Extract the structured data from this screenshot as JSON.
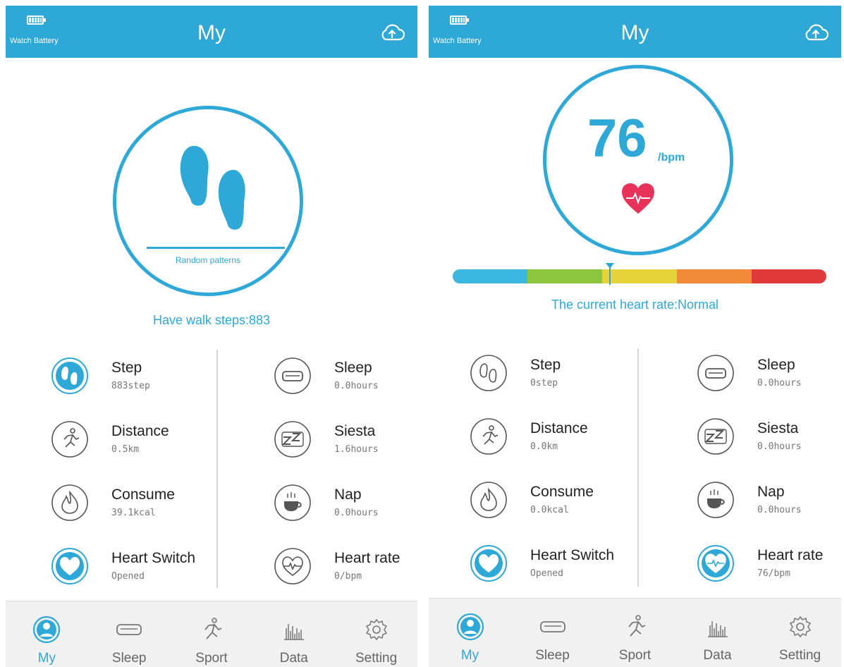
{
  "theme": {
    "accent": "#2ea8d6",
    "heart": "#e8325a"
  },
  "left": {
    "battery_label": "Watch Battery",
    "title": "My",
    "circle_label": "Random patterns",
    "caption": "Have walk steps:883",
    "items": [
      {
        "name": "Step",
        "value": "883step",
        "icon": "footsteps-icon"
      },
      {
        "name": "Sleep",
        "value": "0.0hours",
        "icon": "bed-icon"
      },
      {
        "name": "Distance",
        "value": "0.5km",
        "icon": "runner-icon"
      },
      {
        "name": "Siesta",
        "value": "1.6hours",
        "icon": "zz-icon"
      },
      {
        "name": "Consume",
        "value": "39.1kcal",
        "icon": "flame-icon"
      },
      {
        "name": "Nap",
        "value": "0.0hours",
        "icon": "cup-icon"
      },
      {
        "name": "Heart Switch",
        "value": "Opened",
        "icon": "heart-icon"
      },
      {
        "name": "Heart rate",
        "value": "0/bpm",
        "icon": "heart-rate-icon"
      }
    ],
    "tabs": [
      "My",
      "Sleep",
      "Sport",
      "Data",
      "Setting"
    ]
  },
  "right": {
    "battery_label": "Watch Battery",
    "title": "My",
    "bpm_value": "76",
    "bpm_unit": "/bpm",
    "caption": "The current heart rate:Normal",
    "rate_marker_fraction": 0.42,
    "rate_colors": [
      "#3cb7e0",
      "#8cc63f",
      "#e5d53a",
      "#f08a3a",
      "#e03a3a"
    ],
    "items": [
      {
        "name": "Step",
        "value": "0step",
        "icon": "footsteps-icon"
      },
      {
        "name": "Sleep",
        "value": "0.0hours",
        "icon": "bed-icon"
      },
      {
        "name": "Distance",
        "value": "0.0km",
        "icon": "runner-icon"
      },
      {
        "name": "Siesta",
        "value": "0.0hours",
        "icon": "zz-icon"
      },
      {
        "name": "Consume",
        "value": "0.0kcal",
        "icon": "flame-icon"
      },
      {
        "name": "Nap",
        "value": "0.0hours",
        "icon": "cup-icon"
      },
      {
        "name": "Heart Switch",
        "value": "Opened",
        "icon": "heart-icon"
      },
      {
        "name": "Heart rate",
        "value": "76/bpm",
        "icon": "heart-rate-icon"
      }
    ],
    "tabs": [
      "My",
      "Sleep",
      "Sport",
      "Data",
      "Setting"
    ]
  }
}
